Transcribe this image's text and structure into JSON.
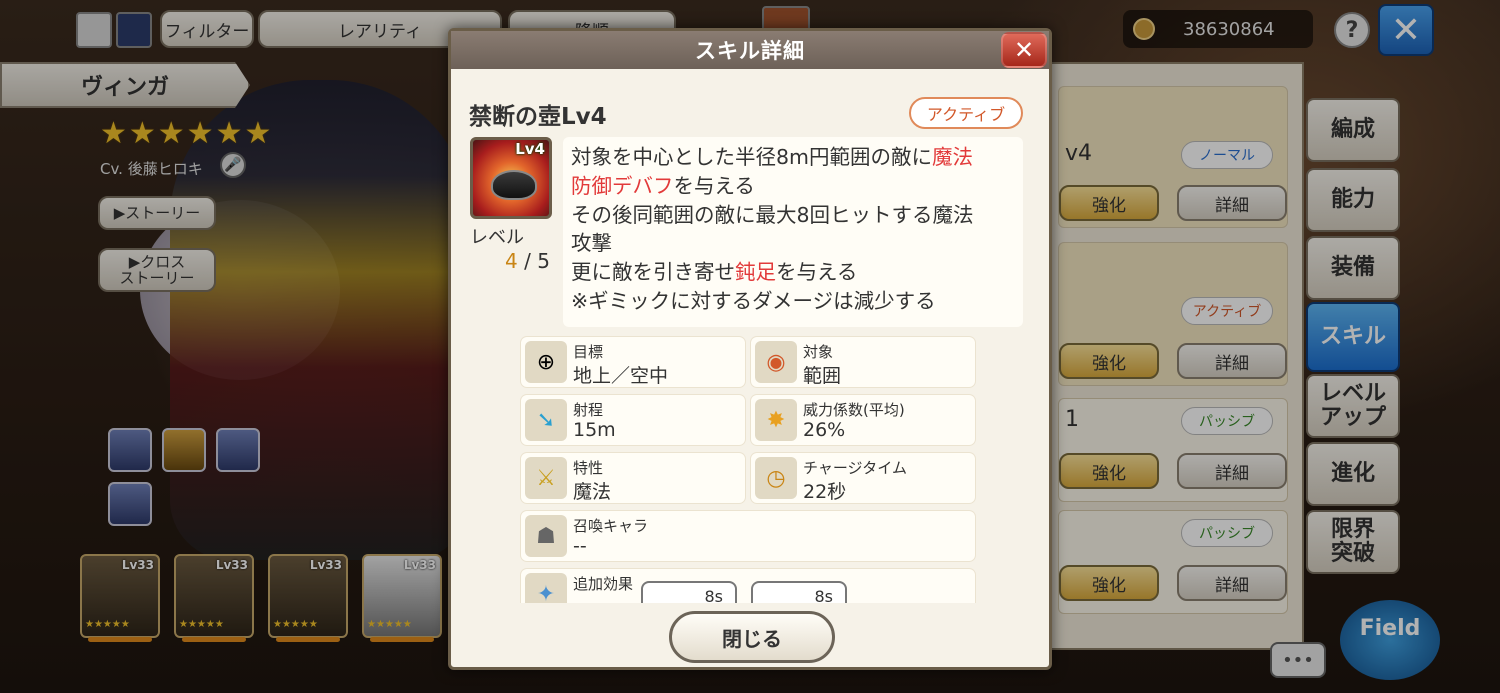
{
  "topbar": {
    "filter_label": "フィルター",
    "rarity_label": "レアリティ",
    "sort_label": "降順",
    "currency_value": "38630864",
    "help_label": "?",
    "close_label": "✕"
  },
  "character": {
    "name": "ヴィンガ",
    "stars": "★★★★★★",
    "cv": "Cv. 後藤ヒロキ",
    "story_label": "▶ストーリー",
    "cross_story_label": "▶クロス\nストーリー"
  },
  "party": [
    {
      "lv": "Lv33"
    },
    {
      "lv": "Lv33"
    },
    {
      "lv": "Lv33"
    },
    {
      "lv": "Lv33"
    }
  ],
  "party_stars": "★★★★★",
  "right_panel": {
    "cards": [
      {
        "title": "v4",
        "badge": "ノーマル",
        "badge_color": "#2a6fd0"
      },
      {
        "title": "",
        "badge": "アクティブ",
        "badge_color": "#d2582a"
      },
      {
        "title": "1",
        "badge": "パッシブ",
        "badge_color": "#3a8a2a"
      },
      {
        "title": "",
        "badge": "パッシブ",
        "badge_color": "#3a8a2a"
      }
    ],
    "enhance_label": "強化",
    "detail_label": "詳細",
    "tabs": [
      "編成",
      "能力",
      "装備",
      "スキル",
      "レベル\nアップ",
      "進化",
      "限界\n突破"
    ],
    "field_label": "Field",
    "chat_label": "•••"
  },
  "modal": {
    "title": "スキル詳細",
    "close_icon": "✕",
    "skill_name": "禁断の壺Lv4",
    "skill_type": "アクティブ",
    "skill_icon_lv": "Lv4",
    "level_label": "レベル",
    "level_current": "4",
    "level_max": "/ 5",
    "desc": {
      "l1a": "対象を中心とした半径8m円範囲の敵に",
      "l1b": "魔法",
      "l2a": "防御デバフ",
      "l2b": "を与える",
      "l3": "その後同範囲の敵に最大8回ヒットする魔法",
      "l4": "攻撃",
      "l5a": "更に敵を引き寄せ",
      "l5b": "鈍足",
      "l5c": "を与える",
      "l6": "※ギミックに対するダメージは減少する"
    },
    "attrs": {
      "target_label": "目標",
      "target_value": "地上／空中",
      "object_label": "対象",
      "object_value": "範囲",
      "range_label": "射程",
      "range_value": "15m",
      "power_label": "威力係数(平均)",
      "power_value": "26%",
      "trait_label": "特性",
      "trait_value": "魔法",
      "charge_label": "チャージタイム",
      "charge_value": "22秒",
      "summon_label": "召喚キャラ",
      "summon_value": "--",
      "extra_label": "追加効果",
      "chip1": "8s",
      "chip2": "8s"
    },
    "close_button": "閉じる"
  },
  "colors": {
    "accent_red": "#e23a3a",
    "active_blue": "#1c6fd0",
    "gold_button": "#d9aa3d"
  }
}
